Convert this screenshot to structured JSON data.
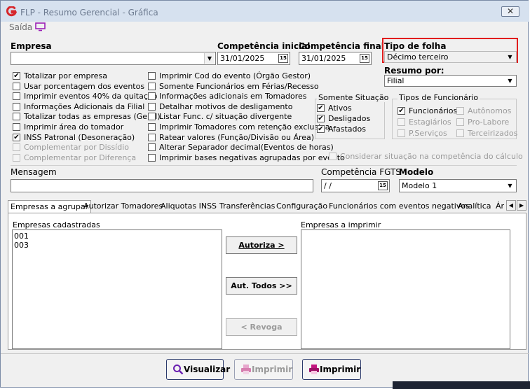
{
  "window": {
    "title": "FLP - Resumo Gerencial - Gráfica",
    "close_label": "✕"
  },
  "menu": {
    "saida": "Saída"
  },
  "empresa": {
    "label": "Empresa",
    "value": ""
  },
  "competencia_inicial": {
    "label": "Competência inicial",
    "value": "31/01/2025"
  },
  "competencia_final": {
    "label": "Competência final",
    "value": "31/01/2025"
  },
  "tipo_folha": {
    "label": "Tipo de folha",
    "value": "Décimo terceiro"
  },
  "resumo_por": {
    "label": "Resumo por:",
    "value": "Filial"
  },
  "calendar_glyph": "15",
  "checks_col1": [
    {
      "label": "Totalizar por empresa",
      "checked": true,
      "enabled": true
    },
    {
      "label": "Usar porcentagem dos eventos",
      "checked": false,
      "enabled": true
    },
    {
      "label": "Imprimir eventos 40% da quitação",
      "checked": false,
      "enabled": true
    },
    {
      "label": "Informações Adicionais da Filial",
      "checked": false,
      "enabled": true
    },
    {
      "label": "Totalizar todas as empresas (Geral)",
      "checked": false,
      "enabled": true
    },
    {
      "label": "Imprimir área do tomador",
      "checked": false,
      "enabled": true
    },
    {
      "label": "INSS Patronal (Desoneração)",
      "checked": true,
      "enabled": true
    },
    {
      "label": "Complementar por Dissídio",
      "checked": false,
      "enabled": false
    },
    {
      "label": "Complementar por Diferença",
      "checked": false,
      "enabled": false
    }
  ],
  "checks_col2": [
    {
      "label": "Imprimir Cod do evento (Órgão Gestor)",
      "checked": false,
      "enabled": true
    },
    {
      "label": "Somente Funcionários em Férias/Recesso",
      "checked": false,
      "enabled": true
    },
    {
      "label": "Informações adicionais em Tomadores",
      "checked": false,
      "enabled": true
    },
    {
      "label": "Detalhar motivos de desligamento",
      "checked": false,
      "enabled": true
    },
    {
      "label": "Listar Func. c/ situação divergente",
      "checked": false,
      "enabled": true
    },
    {
      "label": "Imprimir Tomadores com retenção exclusiva",
      "checked": false,
      "enabled": true
    },
    {
      "label": "Ratear valores (Função/Divisão ou Área)",
      "checked": false,
      "enabled": true
    },
    {
      "label": "Alterar Separador decimal(Eventos de horas)",
      "checked": false,
      "enabled": true
    },
    {
      "label": "Imprimir bases negativas agrupadas por evento",
      "checked": false,
      "enabled": true
    }
  ],
  "somente_situacao": {
    "title": "Somente Situação",
    "items": [
      {
        "label": "Ativos",
        "checked": true
      },
      {
        "label": "Desligados",
        "checked": true
      },
      {
        "label": "Afastados",
        "checked": true
      }
    ]
  },
  "tipos_funcionario": {
    "title": "Tipos de Funcionário",
    "items": [
      {
        "label": "Funcionários",
        "checked": true,
        "enabled": true
      },
      {
        "label": "Autônomos",
        "checked": false,
        "enabled": false
      },
      {
        "label": "Estagiários",
        "checked": false,
        "enabled": false
      },
      {
        "label": "Pro-Labore",
        "checked": false,
        "enabled": false
      },
      {
        "label": "P.Serviços",
        "checked": false,
        "enabled": false
      },
      {
        "label": "Terceirizados",
        "checked": false,
        "enabled": false
      }
    ]
  },
  "considerar_situacao": {
    "label": "Considerar situação na competência do cálculo",
    "checked": false
  },
  "mensagem": {
    "label": "Mensagem",
    "value": ""
  },
  "competencia_fgts": {
    "label": "Competência FGTS",
    "value": " / /"
  },
  "modelo": {
    "label": "Modelo",
    "value": "Modelo 1"
  },
  "tabs": [
    "Empresas a agrupar",
    "Autorizar Tomadores",
    "Aliquotas INSS",
    "Transferências",
    "Configuração",
    "Funcionários com eventos negativos",
    "Analítica",
    "Ár"
  ],
  "tab_nav": {
    "left": "◀",
    "right": "▶"
  },
  "empresas_cadastradas": {
    "label": "Empresas cadastradas",
    "items": [
      "001",
      "003"
    ]
  },
  "empresas_imprimir": {
    "label": "Empresas a imprimir",
    "items": []
  },
  "buttons": {
    "autoriza": "Autoriza >",
    "aut_todos": "Aut. Todos >>",
    "revoga": "< Revoga",
    "visualizar": "Visualizar",
    "imprimir_disabled": "Imprimir",
    "imprimir": "Imprimir"
  },
  "colors": {
    "accent_red": "#e11d1d",
    "logo_red": "#d6262b",
    "printer_magenta": "#c2147f",
    "titlebar": "#d6e1ef"
  },
  "icons": [
    "app-logo-icon",
    "monitor-icon",
    "magnifier-icon",
    "printer-icon"
  ]
}
